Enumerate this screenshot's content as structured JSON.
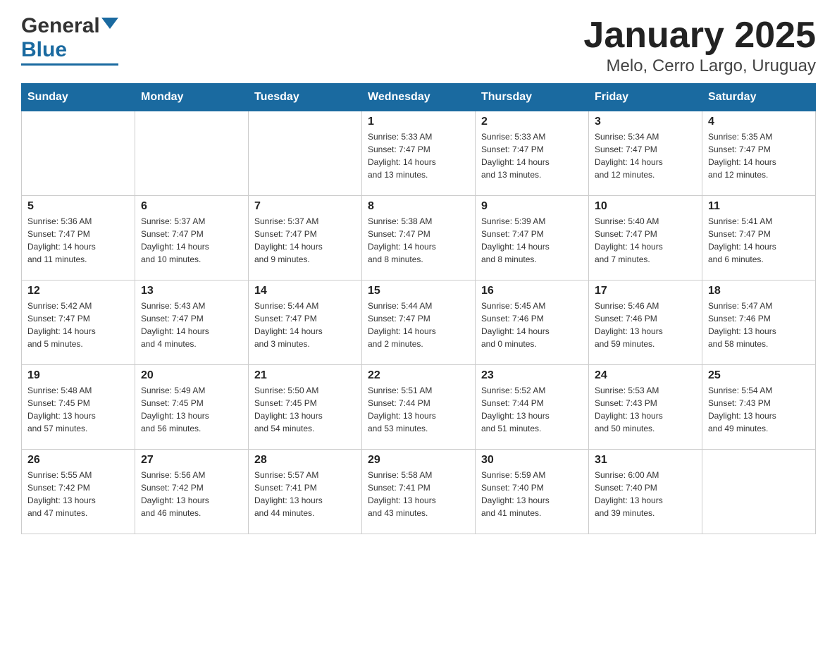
{
  "logo": {
    "general": "General",
    "blue": "Blue"
  },
  "title": "January 2025",
  "subtitle": "Melo, Cerro Largo, Uruguay",
  "weekdays": [
    "Sunday",
    "Monday",
    "Tuesday",
    "Wednesday",
    "Thursday",
    "Friday",
    "Saturday"
  ],
  "weeks": [
    [
      {
        "day": "",
        "info": ""
      },
      {
        "day": "",
        "info": ""
      },
      {
        "day": "",
        "info": ""
      },
      {
        "day": "1",
        "info": "Sunrise: 5:33 AM\nSunset: 7:47 PM\nDaylight: 14 hours\nand 13 minutes."
      },
      {
        "day": "2",
        "info": "Sunrise: 5:33 AM\nSunset: 7:47 PM\nDaylight: 14 hours\nand 13 minutes."
      },
      {
        "day": "3",
        "info": "Sunrise: 5:34 AM\nSunset: 7:47 PM\nDaylight: 14 hours\nand 12 minutes."
      },
      {
        "day": "4",
        "info": "Sunrise: 5:35 AM\nSunset: 7:47 PM\nDaylight: 14 hours\nand 12 minutes."
      }
    ],
    [
      {
        "day": "5",
        "info": "Sunrise: 5:36 AM\nSunset: 7:47 PM\nDaylight: 14 hours\nand 11 minutes."
      },
      {
        "day": "6",
        "info": "Sunrise: 5:37 AM\nSunset: 7:47 PM\nDaylight: 14 hours\nand 10 minutes."
      },
      {
        "day": "7",
        "info": "Sunrise: 5:37 AM\nSunset: 7:47 PM\nDaylight: 14 hours\nand 9 minutes."
      },
      {
        "day": "8",
        "info": "Sunrise: 5:38 AM\nSunset: 7:47 PM\nDaylight: 14 hours\nand 8 minutes."
      },
      {
        "day": "9",
        "info": "Sunrise: 5:39 AM\nSunset: 7:47 PM\nDaylight: 14 hours\nand 8 minutes."
      },
      {
        "day": "10",
        "info": "Sunrise: 5:40 AM\nSunset: 7:47 PM\nDaylight: 14 hours\nand 7 minutes."
      },
      {
        "day": "11",
        "info": "Sunrise: 5:41 AM\nSunset: 7:47 PM\nDaylight: 14 hours\nand 6 minutes."
      }
    ],
    [
      {
        "day": "12",
        "info": "Sunrise: 5:42 AM\nSunset: 7:47 PM\nDaylight: 14 hours\nand 5 minutes."
      },
      {
        "day": "13",
        "info": "Sunrise: 5:43 AM\nSunset: 7:47 PM\nDaylight: 14 hours\nand 4 minutes."
      },
      {
        "day": "14",
        "info": "Sunrise: 5:44 AM\nSunset: 7:47 PM\nDaylight: 14 hours\nand 3 minutes."
      },
      {
        "day": "15",
        "info": "Sunrise: 5:44 AM\nSunset: 7:47 PM\nDaylight: 14 hours\nand 2 minutes."
      },
      {
        "day": "16",
        "info": "Sunrise: 5:45 AM\nSunset: 7:46 PM\nDaylight: 14 hours\nand 0 minutes."
      },
      {
        "day": "17",
        "info": "Sunrise: 5:46 AM\nSunset: 7:46 PM\nDaylight: 13 hours\nand 59 minutes."
      },
      {
        "day": "18",
        "info": "Sunrise: 5:47 AM\nSunset: 7:46 PM\nDaylight: 13 hours\nand 58 minutes."
      }
    ],
    [
      {
        "day": "19",
        "info": "Sunrise: 5:48 AM\nSunset: 7:45 PM\nDaylight: 13 hours\nand 57 minutes."
      },
      {
        "day": "20",
        "info": "Sunrise: 5:49 AM\nSunset: 7:45 PM\nDaylight: 13 hours\nand 56 minutes."
      },
      {
        "day": "21",
        "info": "Sunrise: 5:50 AM\nSunset: 7:45 PM\nDaylight: 13 hours\nand 54 minutes."
      },
      {
        "day": "22",
        "info": "Sunrise: 5:51 AM\nSunset: 7:44 PM\nDaylight: 13 hours\nand 53 minutes."
      },
      {
        "day": "23",
        "info": "Sunrise: 5:52 AM\nSunset: 7:44 PM\nDaylight: 13 hours\nand 51 minutes."
      },
      {
        "day": "24",
        "info": "Sunrise: 5:53 AM\nSunset: 7:43 PM\nDaylight: 13 hours\nand 50 minutes."
      },
      {
        "day": "25",
        "info": "Sunrise: 5:54 AM\nSunset: 7:43 PM\nDaylight: 13 hours\nand 49 minutes."
      }
    ],
    [
      {
        "day": "26",
        "info": "Sunrise: 5:55 AM\nSunset: 7:42 PM\nDaylight: 13 hours\nand 47 minutes."
      },
      {
        "day": "27",
        "info": "Sunrise: 5:56 AM\nSunset: 7:42 PM\nDaylight: 13 hours\nand 46 minutes."
      },
      {
        "day": "28",
        "info": "Sunrise: 5:57 AM\nSunset: 7:41 PM\nDaylight: 13 hours\nand 44 minutes."
      },
      {
        "day": "29",
        "info": "Sunrise: 5:58 AM\nSunset: 7:41 PM\nDaylight: 13 hours\nand 43 minutes."
      },
      {
        "day": "30",
        "info": "Sunrise: 5:59 AM\nSunset: 7:40 PM\nDaylight: 13 hours\nand 41 minutes."
      },
      {
        "day": "31",
        "info": "Sunrise: 6:00 AM\nSunset: 7:40 PM\nDaylight: 13 hours\nand 39 minutes."
      },
      {
        "day": "",
        "info": ""
      }
    ]
  ]
}
